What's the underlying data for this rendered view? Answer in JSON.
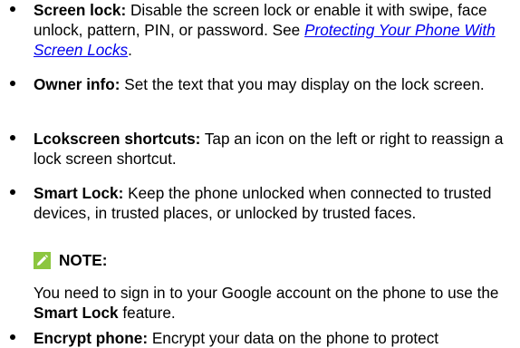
{
  "items": [
    {
      "term": "Screen lock:",
      "text": " Disable the screen lock or enable it with swipe, face unlock, pattern, PIN, or password. See ",
      "link": "Protecting Your Phone With Screen Locks",
      "after": "."
    },
    {
      "term": "Owner info:",
      "text": " Set the text that you may display on the lock screen."
    },
    {
      "term": "Lcokscreen shortcuts:",
      "text": " Tap an icon on the left or right to reassign a lock screen shortcut."
    },
    {
      "term": "Smart Lock:",
      "text": " Keep the phone unlocked when connected to trusted devices, in trusted places, or unlocked by trusted faces."
    },
    {
      "term": "Encrypt phone:",
      "text": " Encrypt your data on the phone to protect"
    }
  ],
  "note": {
    "label": "NOTE:",
    "text_before": "You need to sign in to your Google account on the phone to use the ",
    "bold": "Smart Lock",
    "text_after": " feature.",
    "icon_color": "#8cc63f"
  }
}
